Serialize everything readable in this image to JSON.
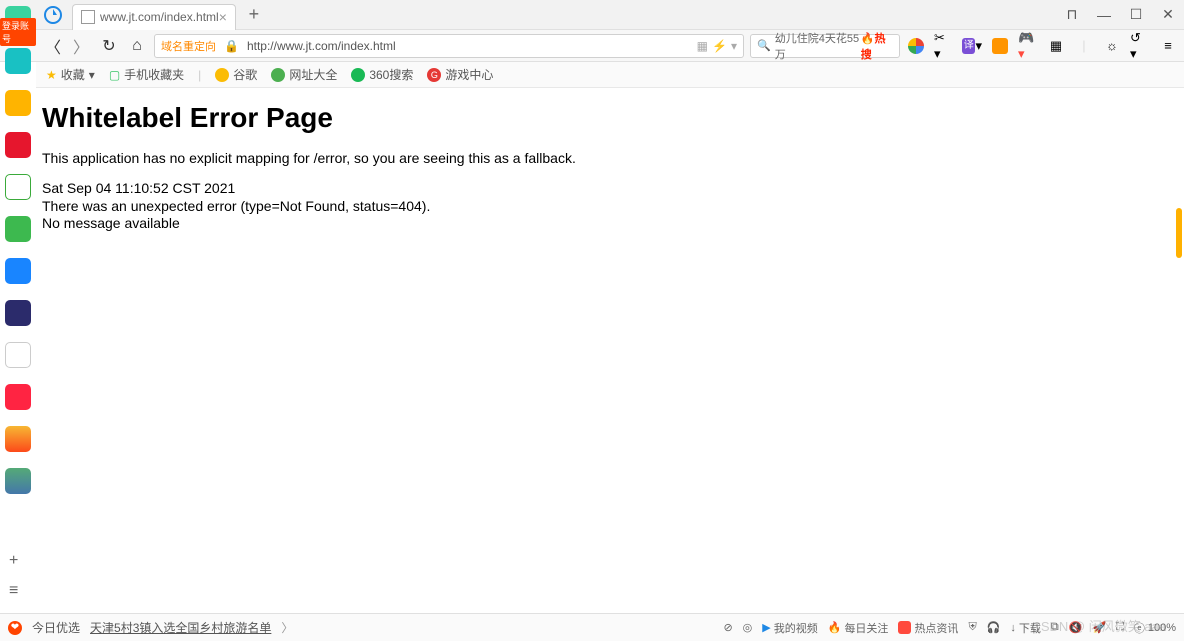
{
  "tab": {
    "title": "www.jt.com/index.html"
  },
  "window_controls": {
    "pin": "⊓",
    "min": "—",
    "max": "☐",
    "close": "✕"
  },
  "login_tag": "登录账号",
  "address": {
    "redirect_label": "域名重定向",
    "lock_icon": "lock-icon",
    "url": "http://www.jt.com/index.html",
    "qr": "▦",
    "fast": "⚡"
  },
  "search": {
    "magnifier": "🔍",
    "text": "幼儿住院4天花55万",
    "hot": "🔥热搜"
  },
  "bookmarks": {
    "fav": "收藏",
    "mobile": "手机收藏夹",
    "google": "谷歌",
    "sitedir": "网址大全",
    "so360": "360搜索",
    "gamectr": "游戏中心"
  },
  "page": {
    "title": "Whitelabel Error Page",
    "sub": "This application has no explicit mapping for /error, so you are seeing this as a fallback.",
    "line1": "Sat Sep 04 11:10:52 CST 2021",
    "line2": "There was an unexpected error (type=Not Found, status=404).",
    "line3": "No message available"
  },
  "bottombar": {
    "today": "今日优选",
    "news": "天津5村3镇入选全国乡村旅游名单",
    "my_video": "我的视频",
    "daily": "每日关注",
    "hot_news": "热点资讯",
    "download": "下载",
    "zoom": "100%"
  },
  "watermark": "CSDN @ 闲风微笑 aaa"
}
